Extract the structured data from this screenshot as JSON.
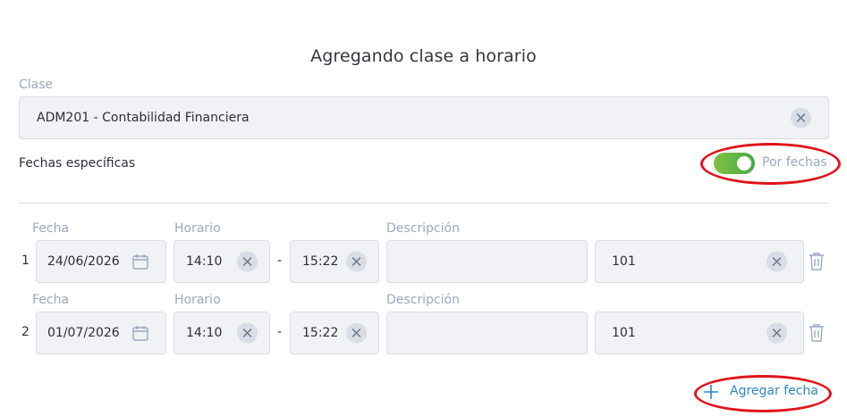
{
  "dialog": {
    "title": "Agregando clase a horario",
    "class_label": "Clase",
    "class_value": "ADM201 - Contabilidad Financiera",
    "specific_dates_label": "Fechas específicas",
    "toggle": {
      "label": "Por fechas",
      "on": true
    },
    "add_date_label": "Agregar fecha"
  },
  "columns": {
    "date": "Fecha",
    "schedule": "Horario",
    "description": "Descripción"
  },
  "rows": [
    {
      "index": "1",
      "date": "24/06/2026",
      "start": "14:10",
      "end": "15:22",
      "description": "",
      "room": "101"
    },
    {
      "index": "2",
      "date": "01/07/2026",
      "start": "14:10",
      "end": "15:22",
      "description": "",
      "room": "101"
    }
  ],
  "colors": {
    "toggle_on": "#4aa84a",
    "link": "#2e86c8",
    "annotation": "#e0141b",
    "label": "#9aa8bf"
  },
  "icons": [
    "calendar-icon",
    "clear-icon",
    "trash-icon",
    "plus-icon"
  ]
}
